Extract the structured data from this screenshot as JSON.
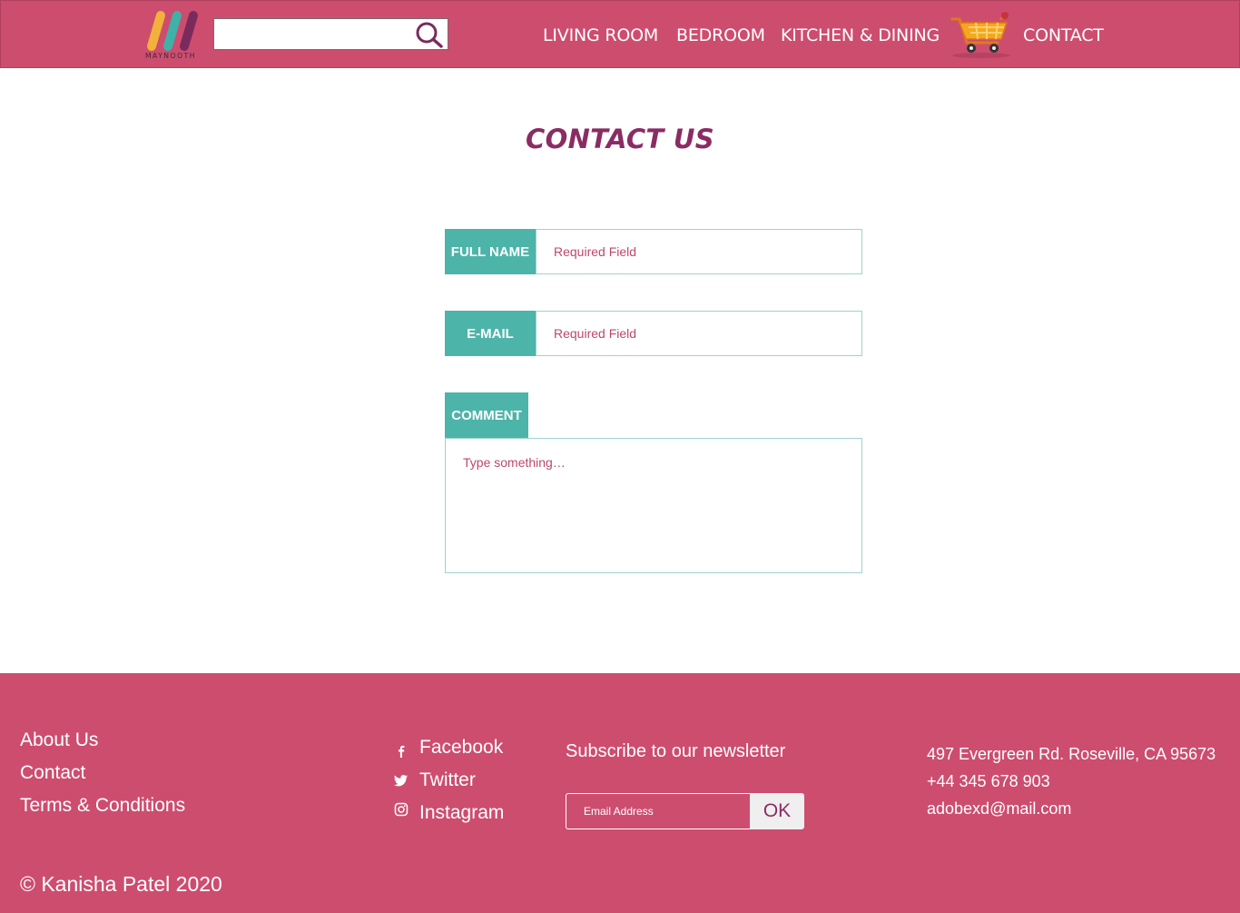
{
  "header": {
    "logo_text": "MAYNOOTH",
    "search": {
      "value": "",
      "placeholder": ""
    },
    "nav": {
      "living_room": "LIVING ROOM",
      "bedroom": "BEDROOM",
      "kitchen_dining": "KITCHEN & DINING",
      "contact": "CONTACT"
    },
    "icons": {
      "search": "search-icon",
      "cart": "cart-icon"
    }
  },
  "main": {
    "title": "CONTACT US",
    "form": {
      "full_name": {
        "label": "FULL NAME",
        "value": "",
        "placeholder": "Required Field"
      },
      "email": {
        "label": "E-MAIL",
        "value": "",
        "placeholder": "Required Field"
      },
      "comment": {
        "label": "COMMENT",
        "value": "",
        "placeholder": "Type something…"
      }
    }
  },
  "footer": {
    "links": {
      "about": "About Us",
      "contact": "Contact",
      "terms": "Terms & Conditions"
    },
    "social": {
      "facebook": "Facebook",
      "twitter": "Twitter",
      "instagram": "Instagram"
    },
    "newsletter": {
      "title": "Subscribe to our newsletter",
      "placeholder": "Email Address",
      "value": "",
      "button": "OK"
    },
    "contact_info": {
      "address": "497 Evergreen Rd. Roseville, CA 95673",
      "phone": "+44 345 678 903",
      "email": "adobexd@mail.com"
    },
    "copyright": "© Kanisha Patel 2020"
  },
  "colors": {
    "brand_pink": "#cd4d6f",
    "title_purple": "#8a2c63",
    "teal": "#4db4a9",
    "placeholder_pink": "#c0466a"
  }
}
